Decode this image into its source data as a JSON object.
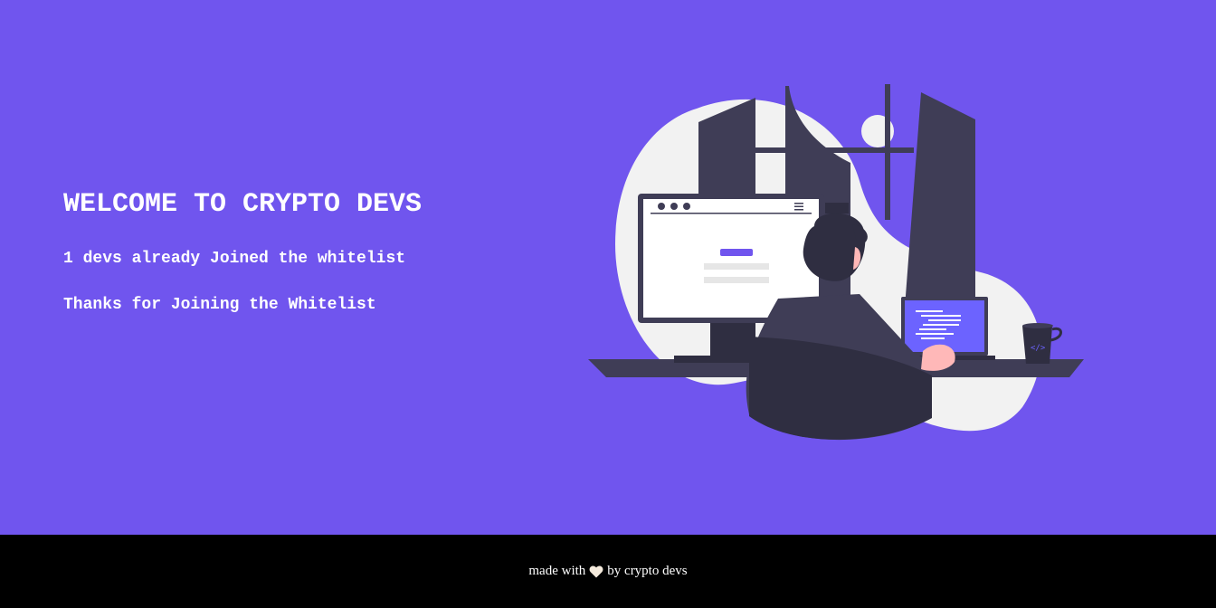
{
  "main": {
    "title": "WELCOME TO CRYPTO DEVS",
    "joined_count_text": "1 devs already Joined the whitelist",
    "status_text": "Thanks for Joining the Whitelist",
    "background_color": "#7055ee",
    "illustration_icon": "developer-at-desk-illustration"
  },
  "footer": {
    "prefix": "made with",
    "icon": "heart-icon",
    "suffix": "by crypto devs",
    "background_color": "#000000"
  }
}
